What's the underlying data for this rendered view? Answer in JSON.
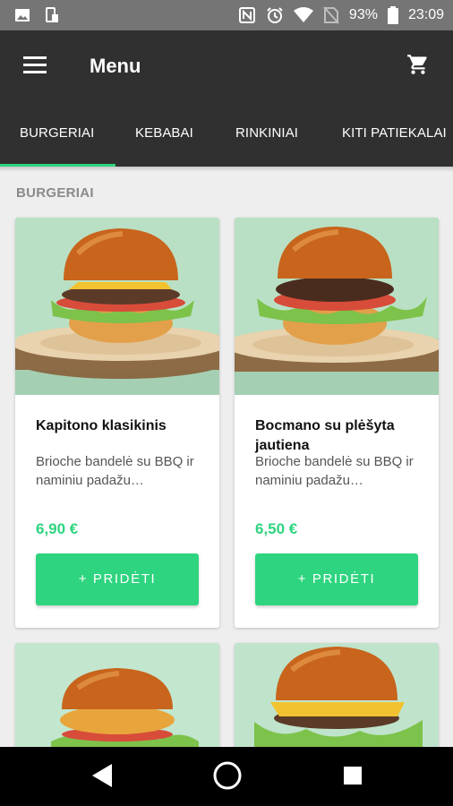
{
  "status_bar": {
    "battery": "93%",
    "time": "23:09"
  },
  "app_bar": {
    "title": "Menu"
  },
  "tabs": [
    {
      "label": "BURGERIAI",
      "selected": true
    },
    {
      "label": "KEBABAI",
      "selected": false
    },
    {
      "label": "RINKINIAI",
      "selected": false
    },
    {
      "label": "KITI PATIEKALAI",
      "selected": false
    }
  ],
  "section": {
    "title": "BURGERIAI"
  },
  "products": [
    {
      "name": "Kapitono klasikinis",
      "description": "Brioche bandelė su BBQ ir naminiu padažu…",
      "price": "6,90 €",
      "button": "+ PRIDĖTI"
    },
    {
      "name": "Bocmano su plėšyta jautiena",
      "description": "Brioche bandelė su BBQ ir naminiu padažu…",
      "price": "6,50 €",
      "button": "+ PRIDĖTI"
    }
  ],
  "colors": {
    "accent": "#2ed47f",
    "app_bar": "#303030",
    "background": "#eeeeee"
  }
}
